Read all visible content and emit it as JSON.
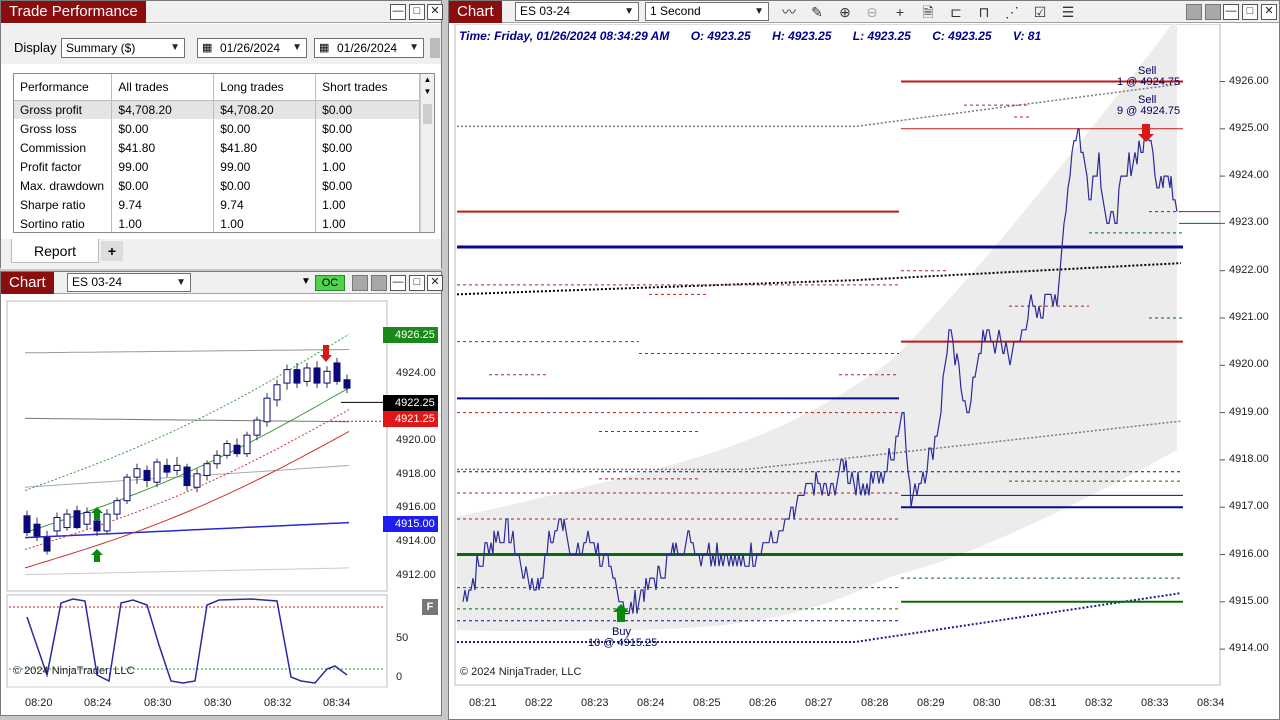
{
  "trade_perf": {
    "title": "Trade Performance",
    "display_label": "Display",
    "display_value": "Summary ($)",
    "date_from": "01/26/2024",
    "date_to": "01/26/2024",
    "columns": [
      "Performance",
      "All trades",
      "Long trades",
      "Short trades"
    ],
    "rows": [
      [
        "Gross profit",
        "$4,708.20",
        "$4,708.20",
        "$0.00"
      ],
      [
        "Gross loss",
        "$0.00",
        "$0.00",
        "$0.00"
      ],
      [
        "Commission",
        "$41.80",
        "$41.80",
        "$0.00"
      ],
      [
        "Profit factor",
        "99.00",
        "99.00",
        "1.00"
      ],
      [
        "Max. drawdown",
        "$0.00",
        "$0.00",
        "$0.00"
      ],
      [
        "Sharpe ratio",
        "9.74",
        "9.74",
        "1.00"
      ],
      [
        "Sortino ratio",
        "1.00",
        "1.00",
        "1.00"
      ]
    ],
    "tab_report": "Report",
    "tab_add": "+"
  },
  "small_chart": {
    "title": "Chart",
    "instrument": "ES 03-24",
    "oc_badge": "OC",
    "copyright": "© 2024 NinjaTrader, LLC",
    "price_ticks": [
      "4924.00",
      "4920.00",
      "4918.00",
      "4916.00",
      "4914.00",
      "4912.00"
    ],
    "tags": {
      "green": "4926.25",
      "black": "4922.25",
      "red": "4921.25",
      "blue": "4915.00"
    },
    "osc_ticks": [
      "50",
      "0"
    ],
    "osc_button": "F",
    "time_ticks": [
      "08:20",
      "08:24",
      "08:30",
      "08:30",
      "08:32",
      "08:34"
    ]
  },
  "main_chart": {
    "title": "Chart",
    "instrument": "ES 03-24",
    "interval": "1 Second",
    "info": {
      "time": "Time: Friday, 01/26/2024 08:34:29 AM",
      "open": "O: 4923.25",
      "high": "H: 4923.25",
      "low": "L: 4923.25",
      "close": "C: 4923.25",
      "volume": "V: 81"
    },
    "copyright": "© 2024 NinjaTrader, LLC",
    "price_ticks": [
      "4926.00",
      "4925.00",
      "4924.00",
      "4923.00",
      "4922.00",
      "4921.00",
      "4920.00",
      "4919.00",
      "4918.00",
      "4917.00",
      "4916.00",
      "4915.00",
      "4914.00"
    ],
    "time_ticks": [
      "08:21",
      "08:22",
      "08:23",
      "08:24",
      "08:25",
      "08:26",
      "08:27",
      "08:28",
      "08:29",
      "08:30",
      "08:31",
      "08:32",
      "08:33",
      "08:34"
    ],
    "sell1_a": "Sell",
    "sell1_b": "1 @ 4924.75",
    "sell2_a": "Sell",
    "sell2_b": "9 @ 4924.75",
    "buy_a": "Buy",
    "buy_b": "10 @ 4915.25"
  },
  "colors": {
    "title_red": "#8b0d0d",
    "up_green": "#0a7a0a",
    "down_red": "#e81e1e",
    "navy": "#1a1a8c",
    "price_line": "#2b2b9a"
  }
}
